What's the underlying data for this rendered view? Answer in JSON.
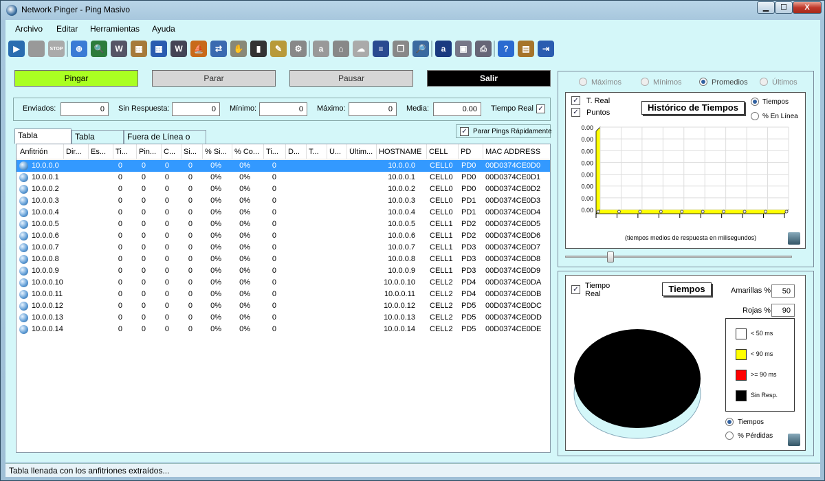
{
  "window": {
    "title": "Network Pinger - Ping Masivo",
    "min": "▁",
    "max": "☐",
    "close": "X"
  },
  "menu": [
    "Archivo",
    "Editar",
    "Herramientas",
    "Ayuda"
  ],
  "toolbar_icons": [
    "play-icon",
    "trash-icon",
    "stop-icon",
    "target-icon",
    "globe-search-icon",
    "www-icon",
    "map-icon",
    "network-grid-icon",
    "wmi-icon",
    "ship-icon",
    "computer-link-icon",
    "hand-icon",
    "terminal-icon",
    "pen-icon",
    "cable-icon",
    "a-icon",
    "bank-icon",
    "cloud-icon",
    "list-icon",
    "copy-icon",
    "find-icon",
    "text-a-icon",
    "save-icon",
    "print-icon",
    "help-icon",
    "chest-icon",
    "exit-icon"
  ],
  "buttons": {
    "ping": "Pingar",
    "stop": "Parar",
    "pause": "Pausar",
    "exit": "Salir"
  },
  "stats": {
    "sent_label": "Enviados:",
    "sent": "0",
    "noresp_label": "Sin Respuesta:",
    "noresp": "0",
    "min_label": "Mínimo:",
    "min": "0",
    "max_label": "Máximo:",
    "max": "0",
    "avg_label": "Media:",
    "avg": "0.00",
    "realtime_label": "Tiempo Real"
  },
  "tabs": [
    "Tabla Principal",
    "Tabla Filtrada",
    "Fuera de Línea o N/D"
  ],
  "fast_stop_label": "Parar Pings Rápidamente",
  "table": {
    "headers": [
      "Anfitrión",
      "Dir...",
      "Es...",
      "Ti...",
      "Pin...",
      "C...",
      "Si...",
      "% Si...",
      "% Co...",
      "Ti...",
      "D...",
      "T...",
      "Ú...",
      "Últim...",
      "HOSTNAME",
      "CELL",
      "PD",
      "MAC ADDRESS"
    ],
    "rows": [
      [
        "10.0.0.0",
        "0",
        "0",
        "0",
        "0",
        "0%",
        "0%",
        "0",
        "10.0.0.0",
        "CELL0",
        "PD0",
        "00D0374CE0D0"
      ],
      [
        "10.0.0.1",
        "0",
        "0",
        "0",
        "0",
        "0%",
        "0%",
        "0",
        "10.0.0.1",
        "CELL0",
        "PD0",
        "00D0374CE0D1"
      ],
      [
        "10.0.0.2",
        "0",
        "0",
        "0",
        "0",
        "0%",
        "0%",
        "0",
        "10.0.0.2",
        "CELL0",
        "PD0",
        "00D0374CE0D2"
      ],
      [
        "10.0.0.3",
        "0",
        "0",
        "0",
        "0",
        "0%",
        "0%",
        "0",
        "10.0.0.3",
        "CELL0",
        "PD1",
        "00D0374CE0D3"
      ],
      [
        "10.0.0.4",
        "0",
        "0",
        "0",
        "0",
        "0%",
        "0%",
        "0",
        "10.0.0.4",
        "CELL0",
        "PD1",
        "00D0374CE0D4"
      ],
      [
        "10.0.0.5",
        "0",
        "0",
        "0",
        "0",
        "0%",
        "0%",
        "0",
        "10.0.0.5",
        "CELL1",
        "PD2",
        "00D0374CE0D5"
      ],
      [
        "10.0.0.6",
        "0",
        "0",
        "0",
        "0",
        "0%",
        "0%",
        "0",
        "10.0.0.6",
        "CELL1",
        "PD2",
        "00D0374CE0D6"
      ],
      [
        "10.0.0.7",
        "0",
        "0",
        "0",
        "0",
        "0%",
        "0%",
        "0",
        "10.0.0.7",
        "CELL1",
        "PD3",
        "00D0374CE0D7"
      ],
      [
        "10.0.0.8",
        "0",
        "0",
        "0",
        "0",
        "0%",
        "0%",
        "0",
        "10.0.0.8",
        "CELL1",
        "PD3",
        "00D0374CE0D8"
      ],
      [
        "10.0.0.9",
        "0",
        "0",
        "0",
        "0",
        "0%",
        "0%",
        "0",
        "10.0.0.9",
        "CELL1",
        "PD3",
        "00D0374CE0D9"
      ],
      [
        "10.0.0.10",
        "0",
        "0",
        "0",
        "0",
        "0%",
        "0%",
        "0",
        "10.0.0.10",
        "CELL2",
        "PD4",
        "00D0374CE0DA"
      ],
      [
        "10.0.0.11",
        "0",
        "0",
        "0",
        "0",
        "0%",
        "0%",
        "0",
        "10.0.0.11",
        "CELL2",
        "PD4",
        "00D0374CE0DB"
      ],
      [
        "10.0.0.12",
        "0",
        "0",
        "0",
        "0",
        "0%",
        "0%",
        "0",
        "10.0.0.12",
        "CELL2",
        "PD5",
        "00D0374CE0DC"
      ],
      [
        "10.0.0.13",
        "0",
        "0",
        "0",
        "0",
        "0%",
        "0%",
        "0",
        "10.0.0.13",
        "CELL2",
        "PD5",
        "00D0374CE0DD"
      ],
      [
        "10.0.0.14",
        "0",
        "0",
        "0",
        "0",
        "0%",
        "0%",
        "0",
        "10.0.0.14",
        "CELL2",
        "PD5",
        "00D0374CE0DE"
      ]
    ],
    "selected_row": 0
  },
  "history": {
    "modes": [
      "Máximos",
      "Mínimos",
      "Promedios",
      "Últimos"
    ],
    "selected_mode": "Promedios",
    "treal_label": "T. Real",
    "points_label": "Puntos",
    "title": "Histórico de Tiempos",
    "opt_times": "Tiempos",
    "opt_online": "% En Línea",
    "y_ticks": [
      "0.00",
      "0.00",
      "0.00",
      "0.00",
      "0.00",
      "0.00",
      "0.00",
      "0.00"
    ],
    "caption": "(tiempos medios de respuesta en milisegundos)",
    "slider_value": 0.2
  },
  "pie": {
    "realtime_label": "Tiempo Real",
    "title": "Tiempos",
    "yellow_label": "Amarillas %",
    "yellow": "50",
    "red_label": "Rojas %",
    "red": "90",
    "legend": [
      {
        "label": "< 50 ms",
        "color": "#ffffff"
      },
      {
        "label": "< 90 ms",
        "color": "#ffff00"
      },
      {
        "label": ">= 90 ms",
        "color": "#ff0000"
      },
      {
        "label": "Sin Resp.",
        "color": "#000000"
      }
    ],
    "opt_times": "Tiempos",
    "opt_loss": "% Pérdidas"
  },
  "status": "Tabla llenada con los anfitriones extraídos..."
}
